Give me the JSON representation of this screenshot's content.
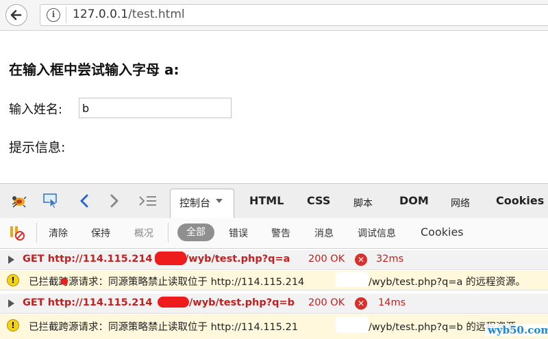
{
  "browser": {
    "url_host": "127.0.0.1",
    "url_path": "/test.html"
  },
  "page": {
    "heading": "在输入框中尝试输入字母 a:",
    "name_label": "输入姓名:",
    "name_value": "b",
    "hint_label": "提示信息:"
  },
  "devtools": {
    "tabs": [
      {
        "label": "控制台",
        "active": true
      },
      {
        "label": "HTML"
      },
      {
        "label": "CSS"
      },
      {
        "label": "脚本"
      },
      {
        "label": "DOM"
      },
      {
        "label": "网络"
      },
      {
        "label": "Cookies"
      }
    ],
    "filters": [
      "清除",
      "保持",
      "概况",
      "全部",
      "错误",
      "警告",
      "消息",
      "调试信息",
      "Cookies"
    ],
    "log": [
      {
        "type": "request",
        "text": "GET http://114.115.214",
        "url_suffix": "/wyb/test.php?q=a",
        "status": "200 OK",
        "time": "32ms"
      },
      {
        "type": "warning",
        "text": "已拦截跨源请求：同源策略禁止读取位于 http://114.115.214",
        "suffix": "/wyb/test.php?q=a 的远程资源。"
      },
      {
        "type": "request",
        "text": "GET http://114.115.214",
        "url_suffix": "/wyb/test.php?q=b",
        "status": "200 OK",
        "time": "14ms"
      },
      {
        "type": "warning",
        "text": "已拦截跨源请求：同源策略禁止读取位于 http://114.115.21",
        "suffix": "/wyb/test.php?q=b 的远程资源。"
      }
    ]
  },
  "watermark": "wyb50.com"
}
